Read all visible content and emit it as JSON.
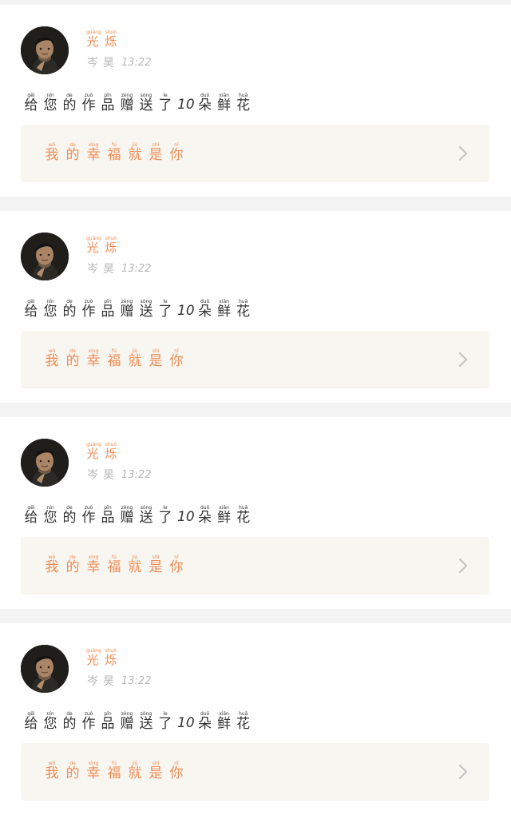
{
  "items": [
    {
      "name": [
        {
          "r": "guāng",
          "c": "光"
        },
        {
          "r": "shuò",
          "c": "烁"
        }
      ],
      "sub": [
        {
          "r": "",
          "c": "岑"
        },
        {
          "r": "",
          "c": "昊"
        }
      ],
      "time": "13:22",
      "message_before": [
        {
          "r": "gěi",
          "c": "给"
        },
        {
          "r": "nín",
          "c": "您"
        },
        {
          "r": "de",
          "c": "的"
        },
        {
          "r": "zuò",
          "c": "作"
        },
        {
          "r": "pǐn",
          "c": "品"
        },
        {
          "r": "zèng",
          "c": "赠"
        },
        {
          "r": "sòng",
          "c": "送"
        },
        {
          "r": "le",
          "c": "了"
        }
      ],
      "number": "10",
      "message_after": [
        {
          "r": "duǒ",
          "c": "朵"
        },
        {
          "r": "xiān",
          "c": "鲜"
        },
        {
          "r": "huā",
          "c": "花"
        }
      ],
      "link": [
        {
          "r": "wǒ",
          "c": "我"
        },
        {
          "r": "de",
          "c": "的"
        },
        {
          "r": "xìng",
          "c": "幸"
        },
        {
          "r": "fú",
          "c": "福"
        },
        {
          "r": "jiù",
          "c": "就"
        },
        {
          "r": "shì",
          "c": "是"
        },
        {
          "r": "nǐ",
          "c": "你"
        }
      ]
    },
    {
      "name": [
        {
          "r": "guāng",
          "c": "光"
        },
        {
          "r": "shuò",
          "c": "烁"
        }
      ],
      "sub": [
        {
          "r": "",
          "c": "岑"
        },
        {
          "r": "",
          "c": "昊"
        }
      ],
      "time": "13:22",
      "message_before": [
        {
          "r": "gěi",
          "c": "给"
        },
        {
          "r": "nín",
          "c": "您"
        },
        {
          "r": "de",
          "c": "的"
        },
        {
          "r": "zuò",
          "c": "作"
        },
        {
          "r": "pǐn",
          "c": "品"
        },
        {
          "r": "zèng",
          "c": "赠"
        },
        {
          "r": "sòng",
          "c": "送"
        },
        {
          "r": "le",
          "c": "了"
        }
      ],
      "number": "10",
      "message_after": [
        {
          "r": "duǒ",
          "c": "朵"
        },
        {
          "r": "xiān",
          "c": "鲜"
        },
        {
          "r": "huā",
          "c": "花"
        }
      ],
      "link": [
        {
          "r": "wǒ",
          "c": "我"
        },
        {
          "r": "de",
          "c": "的"
        },
        {
          "r": "xìng",
          "c": "幸"
        },
        {
          "r": "fú",
          "c": "福"
        },
        {
          "r": "jiù",
          "c": "就"
        },
        {
          "r": "shì",
          "c": "是"
        },
        {
          "r": "nǐ",
          "c": "你"
        }
      ]
    },
    {
      "name": [
        {
          "r": "guāng",
          "c": "光"
        },
        {
          "r": "shuò",
          "c": "烁"
        }
      ],
      "sub": [
        {
          "r": "",
          "c": "岑"
        },
        {
          "r": "",
          "c": "昊"
        }
      ],
      "time": "13:22",
      "message_before": [
        {
          "r": "gěi",
          "c": "给"
        },
        {
          "r": "nín",
          "c": "您"
        },
        {
          "r": "de",
          "c": "的"
        },
        {
          "r": "zuò",
          "c": "作"
        },
        {
          "r": "pǐn",
          "c": "品"
        },
        {
          "r": "zèng",
          "c": "赠"
        },
        {
          "r": "sòng",
          "c": "送"
        },
        {
          "r": "le",
          "c": "了"
        }
      ],
      "number": "10",
      "message_after": [
        {
          "r": "duǒ",
          "c": "朵"
        },
        {
          "r": "xiān",
          "c": "鲜"
        },
        {
          "r": "huā",
          "c": "花"
        }
      ],
      "link": [
        {
          "r": "wǒ",
          "c": "我"
        },
        {
          "r": "de",
          "c": "的"
        },
        {
          "r": "xìng",
          "c": "幸"
        },
        {
          "r": "fú",
          "c": "福"
        },
        {
          "r": "jiù",
          "c": "就"
        },
        {
          "r": "shì",
          "c": "是"
        },
        {
          "r": "nǐ",
          "c": "你"
        }
      ]
    },
    {
      "name": [
        {
          "r": "guāng",
          "c": "光"
        },
        {
          "r": "shuò",
          "c": "烁"
        }
      ],
      "sub": [
        {
          "r": "",
          "c": "岑"
        },
        {
          "r": "",
          "c": "昊"
        }
      ],
      "time": "13:22",
      "message_before": [
        {
          "r": "gěi",
          "c": "给"
        },
        {
          "r": "nín",
          "c": "您"
        },
        {
          "r": "de",
          "c": "的"
        },
        {
          "r": "zuò",
          "c": "作"
        },
        {
          "r": "pǐn",
          "c": "品"
        },
        {
          "r": "zèng",
          "c": "赠"
        },
        {
          "r": "sòng",
          "c": "送"
        },
        {
          "r": "le",
          "c": "了"
        }
      ],
      "number": "10",
      "message_after": [
        {
          "r": "duǒ",
          "c": "朵"
        },
        {
          "r": "xiān",
          "c": "鲜"
        },
        {
          "r": "huā",
          "c": "花"
        }
      ],
      "link": [
        {
          "r": "wǒ",
          "c": "我"
        },
        {
          "r": "de",
          "c": "的"
        },
        {
          "r": "xìng",
          "c": "幸"
        },
        {
          "r": "fú",
          "c": "福"
        },
        {
          "r": "jiù",
          "c": "就"
        },
        {
          "r": "shì",
          "c": "是"
        },
        {
          "r": "nǐ",
          "c": "你"
        }
      ]
    }
  ],
  "icons": {
    "chevron": "chevron-right-icon",
    "avatar": "avatar"
  },
  "colors": {
    "accent": "#f08b52",
    "card_bg": "#ffffff",
    "page_bg": "#f3f3f3",
    "box_bg": "#f8f6f1",
    "muted": "#b7b7b7"
  }
}
